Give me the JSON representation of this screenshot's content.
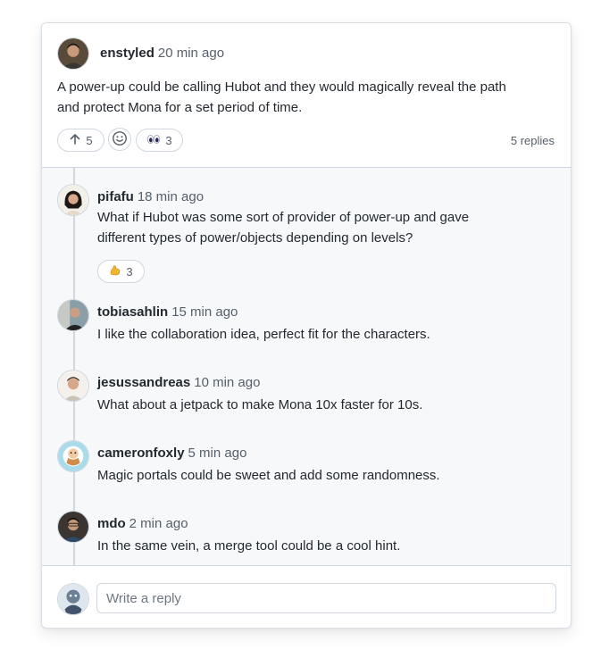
{
  "post": {
    "author": "enstyled",
    "time": "20 min ago",
    "body_line1": "A power-up could be calling Hubot and they would magically reveal the path",
    "body_line2": "and protect Mona for a set period of time.",
    "upvote_count": "5",
    "eyes_count": "3",
    "replies_label": "5 replies"
  },
  "replies": [
    {
      "author": "pifafu",
      "time": "18 min ago",
      "line1": "What if Hubot was some sort of provider of power-up and gave",
      "line2": "different types of power/objects depending on levels?",
      "reaction_count": "3"
    },
    {
      "author": "tobiasahlin",
      "time": "15 min ago",
      "line1": "I like the collaboration idea, perfect fit for the characters."
    },
    {
      "author": "jesussandreas",
      "time": "10 min ago",
      "line1": "What about a jetpack to make Mona 10x faster for 10s."
    },
    {
      "author": "cameronfoxly",
      "time": "5 min ago",
      "line1": "Magic portals could be sweet and add some randomness."
    },
    {
      "author": "mdo",
      "time": "2 min ago",
      "line1": "In the same vein, a merge tool could be a cool hint."
    }
  ],
  "composer": {
    "placeholder": "Write a reply"
  },
  "colors": {
    "accent_border": "#d0d7de",
    "muted_text": "#57606a",
    "thread_bg": "#f6f8fa"
  }
}
